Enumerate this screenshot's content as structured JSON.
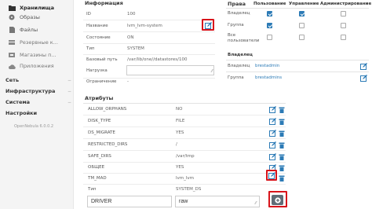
{
  "sidebar": {
    "items": [
      {
        "label": "Хранилища",
        "icon": "folder-icon"
      },
      {
        "label": "Образы",
        "icon": "disk-icon"
      },
      {
        "label": "Файлы",
        "icon": "file-icon"
      },
      {
        "label": "Резервные к...",
        "icon": "backup-icon"
      },
      {
        "label": "Магазины п...",
        "icon": "store-icon"
      },
      {
        "label": "Приложения",
        "icon": "cloud-icon"
      }
    ],
    "sections": [
      "Сеть",
      "Инфраструктура",
      "Система",
      "Настройки"
    ],
    "version": "OpenNebula 6.0.0.2"
  },
  "info": {
    "header": "Информация",
    "rows": [
      {
        "label": "ID",
        "value": "100"
      },
      {
        "label": "Название",
        "value": "lvm_lvm-system"
      },
      {
        "label": "Состояние",
        "value": "ON"
      },
      {
        "label": "Тип",
        "value": "SYSTEM"
      },
      {
        "label": "Базовый путь",
        "value": "/var/lib/one//datastores/100"
      },
      {
        "label": "Нагрузка",
        "value": ""
      },
      {
        "label": "Ограничение",
        "value": "-"
      }
    ]
  },
  "permissions": {
    "header": "Права",
    "columns": [
      "Пользование",
      "Управление",
      "Администрирование"
    ],
    "rows": [
      {
        "label": "Владелец",
        "use": true,
        "manage": true,
        "admin": false
      },
      {
        "label": "Группа",
        "use": true,
        "manage": false,
        "admin": false
      },
      {
        "label": "Все пользователи",
        "use": false,
        "manage": false,
        "admin": false
      }
    ]
  },
  "ownership": {
    "header": "Владелец",
    "rows": [
      {
        "label": "Владелец",
        "value": "brestadmin"
      },
      {
        "label": "Группа",
        "value": "brestadmins"
      }
    ]
  },
  "attributes": {
    "header": "Атрибуты",
    "rows": [
      {
        "key": "ALLOW_ORPHANS",
        "value": "NO"
      },
      {
        "key": "DISK_TYPE",
        "value": "FILE"
      },
      {
        "key": "DS_MIGRATE",
        "value": "YES"
      },
      {
        "key": "RESTRICTED_DIRS",
        "value": "/"
      },
      {
        "key": "SAFE_DIRS",
        "value": "/var/tmp"
      },
      {
        "key": "ОБЩЕЕ",
        "value": "YES"
      },
      {
        "key": "TM_MAD",
        "value": "lvm_lvm"
      },
      {
        "key": "Тип",
        "value": "SYSTEM_DS"
      }
    ],
    "new_key": "DRIVER",
    "new_value": "raw"
  },
  "colors": {
    "accent": "#2c7bb6",
    "highlight": "#d8141b",
    "button": "#606c76"
  }
}
